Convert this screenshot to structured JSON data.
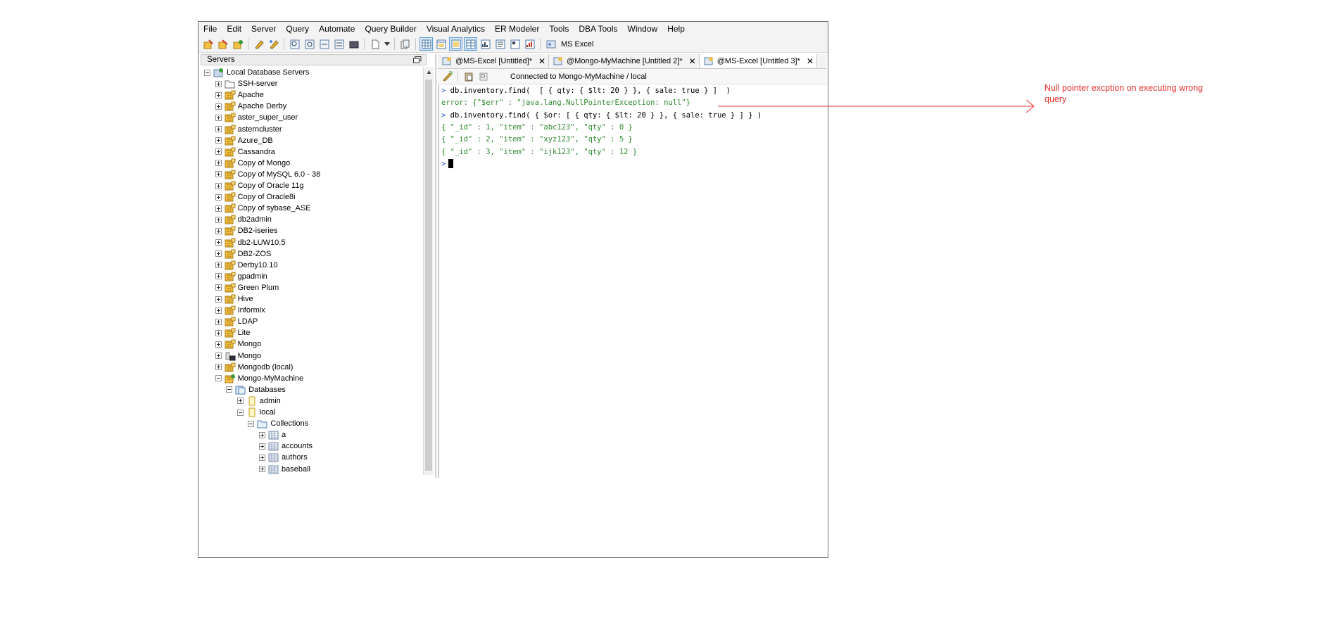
{
  "menu": [
    "File",
    "Edit",
    "Server",
    "Query",
    "Automate",
    "Query Builder",
    "Visual Analytics",
    "ER Modeler",
    "Tools",
    "DBA Tools",
    "Window",
    "Help"
  ],
  "toolbar": {
    "ms_excel_label": "MS Excel"
  },
  "servers_panel": {
    "title": "Servers"
  },
  "tree": [
    {
      "label": "Local Database Servers",
      "level": 0,
      "expander": "minus",
      "icon": "servers-root-icon"
    },
    {
      "label": "SSH-server",
      "level": 1,
      "expander": "plus",
      "icon": "folder-icon"
    },
    {
      "label": "Apache",
      "level": 1,
      "expander": "plus",
      "icon": "database-server-icon"
    },
    {
      "label": "Apache Derby",
      "level": 1,
      "expander": "plus",
      "icon": "database-server-icon"
    },
    {
      "label": "aster_super_user",
      "level": 1,
      "expander": "plus",
      "icon": "database-server-icon"
    },
    {
      "label": "asterncluster",
      "level": 1,
      "expander": "plus",
      "icon": "database-server-icon"
    },
    {
      "label": "Azure_DB",
      "level": 1,
      "expander": "plus",
      "icon": "database-server-icon"
    },
    {
      "label": "Cassandra",
      "level": 1,
      "expander": "plus",
      "icon": "database-server-icon"
    },
    {
      "label": "Copy of Mongo",
      "level": 1,
      "expander": "plus",
      "icon": "database-server-icon"
    },
    {
      "label": "Copy of MySQL 6.0 - 38",
      "level": 1,
      "expander": "plus",
      "icon": "database-server-icon"
    },
    {
      "label": "Copy of Oracle 11g",
      "level": 1,
      "expander": "plus",
      "icon": "database-server-icon"
    },
    {
      "label": "Copy of Oracle8i",
      "level": 1,
      "expander": "plus",
      "icon": "database-server-icon"
    },
    {
      "label": "Copy of sybase_ASE",
      "level": 1,
      "expander": "plus",
      "icon": "database-server-icon"
    },
    {
      "label": "db2admin",
      "level": 1,
      "expander": "plus",
      "icon": "database-server-icon"
    },
    {
      "label": "DB2-iseries",
      "level": 1,
      "expander": "plus",
      "icon": "database-server-icon"
    },
    {
      "label": "db2-LUW10.5",
      "level": 1,
      "expander": "plus",
      "icon": "database-server-icon"
    },
    {
      "label": "DB2-ZOS",
      "level": 1,
      "expander": "plus",
      "icon": "database-server-icon"
    },
    {
      "label": "Derby10.10",
      "level": 1,
      "expander": "plus",
      "icon": "database-server-icon"
    },
    {
      "label": "gpadmin",
      "level": 1,
      "expander": "plus",
      "icon": "database-server-icon"
    },
    {
      "label": "Green Plum",
      "level": 1,
      "expander": "plus",
      "icon": "database-server-icon"
    },
    {
      "label": "Hive",
      "level": 1,
      "expander": "plus",
      "icon": "database-server-icon"
    },
    {
      "label": "Informix",
      "level": 1,
      "expander": "plus",
      "icon": "database-server-icon"
    },
    {
      "label": "LDAP",
      "level": 1,
      "expander": "plus",
      "icon": "database-server-icon"
    },
    {
      "label": "Lite",
      "level": 1,
      "expander": "plus",
      "icon": "database-server-icon"
    },
    {
      "label": "Mongo",
      "level": 1,
      "expander": "plus",
      "icon": "database-server-icon"
    },
    {
      "label": "Mongo",
      "level": 1,
      "expander": "plus",
      "icon": "terminal-server-icon"
    },
    {
      "label": "Mongodb (local)",
      "level": 1,
      "expander": "plus",
      "icon": "database-server-icon"
    },
    {
      "label": "Mongo-MyMachine",
      "level": 1,
      "expander": "minus",
      "icon": "connected-server-icon"
    },
    {
      "label": "Databases",
      "level": 2,
      "expander": "minus",
      "icon": "databases-icon"
    },
    {
      "label": "admin",
      "level": 3,
      "expander": "plus",
      "icon": "database-icon"
    },
    {
      "label": "local",
      "level": 3,
      "expander": "minus",
      "icon": "database-icon"
    },
    {
      "label": "Collections",
      "level": 4,
      "expander": "minus",
      "icon": "collections-folder-icon"
    },
    {
      "label": "a",
      "level": 5,
      "expander": "plus",
      "icon": "table-icon"
    },
    {
      "label": "accounts",
      "level": 5,
      "expander": "plus",
      "icon": "table-icon"
    },
    {
      "label": "authors",
      "level": 5,
      "expander": "plus",
      "icon": "table-icon"
    },
    {
      "label": "baseball",
      "level": 5,
      "expander": "plus",
      "icon": "table-icon"
    }
  ],
  "tabs": [
    {
      "label": "@MS-Excel [Untitled]*",
      "close": "✕",
      "active": false
    },
    {
      "label": "@Mongo-MyMachine [Untitled 2]*",
      "close": "✕",
      "active": false
    },
    {
      "label": "@MS-Excel [Untitled 3]*",
      "close": "✕",
      "active": true
    }
  ],
  "editor": {
    "connection_status": "Connected to Mongo-MyMachine / local"
  },
  "console": [
    {
      "prompt": ">",
      "text": " db.inventory.find(  [ { qty: { $lt: 20 } }, { sale: true } ]  )",
      "kind": "cmd"
    },
    {
      "prompt": "",
      "text": "error: {\"$err\" : \"java.lang.NullPointerException: null\"}",
      "kind": "err"
    },
    {
      "prompt": ">",
      "text": " db.inventory.find( { $or: [ { qty: { $lt: 20 } }, { sale: true } ] } )",
      "kind": "cmd"
    },
    {
      "prompt": "",
      "text": "{ \"_id\" : 1, \"item\" : \"abc123\", \"qty\" : 0 }",
      "kind": "res"
    },
    {
      "prompt": "",
      "text": "{ \"_id\" : 2, \"item\" : \"xyz123\", \"qty\" : 5 }",
      "kind": "res"
    },
    {
      "prompt": "",
      "text": "{ \"_id\" : 3, \"item\" : \"ijk123\", \"qty\" : 12 }",
      "kind": "res"
    },
    {
      "prompt": ">",
      "text": "",
      "kind": "cursor"
    }
  ],
  "annotation": {
    "text": "Null pointer excption on executing wrong query",
    "color": "#e8302c"
  }
}
